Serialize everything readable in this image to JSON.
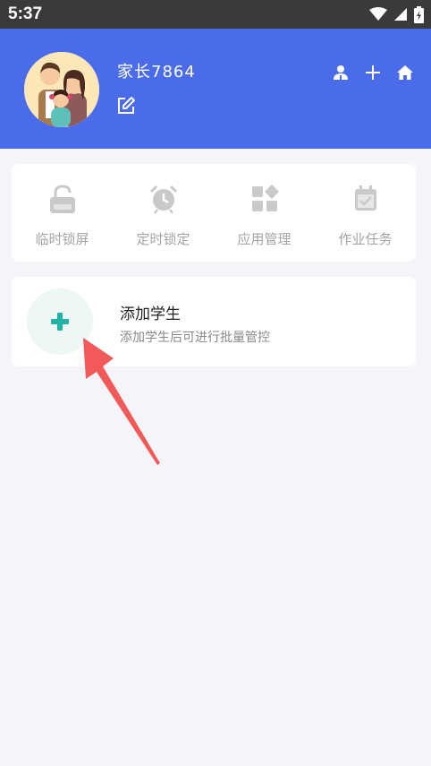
{
  "status_bar": {
    "time": "5:37",
    "icons": [
      "wifi-icon",
      "signal-icon",
      "battery-charging-icon"
    ]
  },
  "header": {
    "username": "家长7864",
    "background_color": "#4a6bea",
    "actions": [
      "profile-icon",
      "add-icon",
      "home-icon"
    ]
  },
  "quick_actions": [
    {
      "label": "临时锁屏",
      "icon": "lock-icon"
    },
    {
      "label": "定时锁定",
      "icon": "alarm-clock-icon"
    },
    {
      "label": "应用管理",
      "icon": "apps-grid-icon"
    },
    {
      "label": "作业任务",
      "icon": "task-calendar-icon"
    }
  ],
  "student_card": {
    "title": "添加学生",
    "subtitle": "添加学生后可进行批量管控",
    "accent_color": "#23b3a6"
  },
  "annotation": {
    "icon": "pointer-arrow-icon",
    "color": "#f25a5a"
  }
}
